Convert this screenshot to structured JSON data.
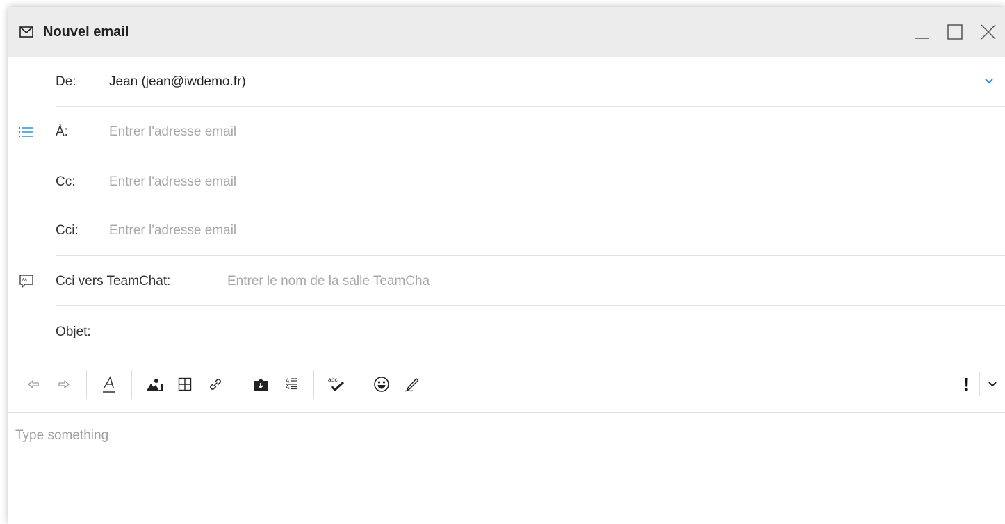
{
  "window": {
    "title": "Nouvel email",
    "controls": {
      "minimize_icon": "minimize-icon",
      "maximize_icon": "maximize-icon",
      "close_icon": "close-icon"
    }
  },
  "compose": {
    "from": {
      "label": "De:",
      "value": "Jean (jean@iwdemo.fr)"
    },
    "to": {
      "label": "À:",
      "placeholder": "Entrer l'adresse email"
    },
    "cc": {
      "label": "Cc:",
      "placeholder": "Entrer l'adresse email"
    },
    "bcc": {
      "label": "Cci:",
      "placeholder": "Entrer l'adresse email"
    },
    "teamchat": {
      "label": "Cci vers TeamChat:",
      "placeholder": "Entrer le nom de la salle TeamCha"
    },
    "subject": {
      "label": "Objet:",
      "value": ""
    }
  },
  "toolbar": {
    "priority_label": "!",
    "icons": [
      "undo-icon",
      "redo-icon",
      "font-format-icon",
      "insert-image-icon",
      "insert-table-icon",
      "insert-link-icon",
      "attach-file-icon",
      "text-block-icon",
      "spellcheck-icon",
      "emoji-icon",
      "signature-icon",
      "priority-icon",
      "more-chevron-icon"
    ]
  },
  "editor": {
    "placeholder": "Type something"
  },
  "colors": {
    "accent": "#1a8fd8",
    "titlebar_bg": "#ececec",
    "placeholder": "#a8a8a8",
    "separator": "#e2e2e2"
  }
}
